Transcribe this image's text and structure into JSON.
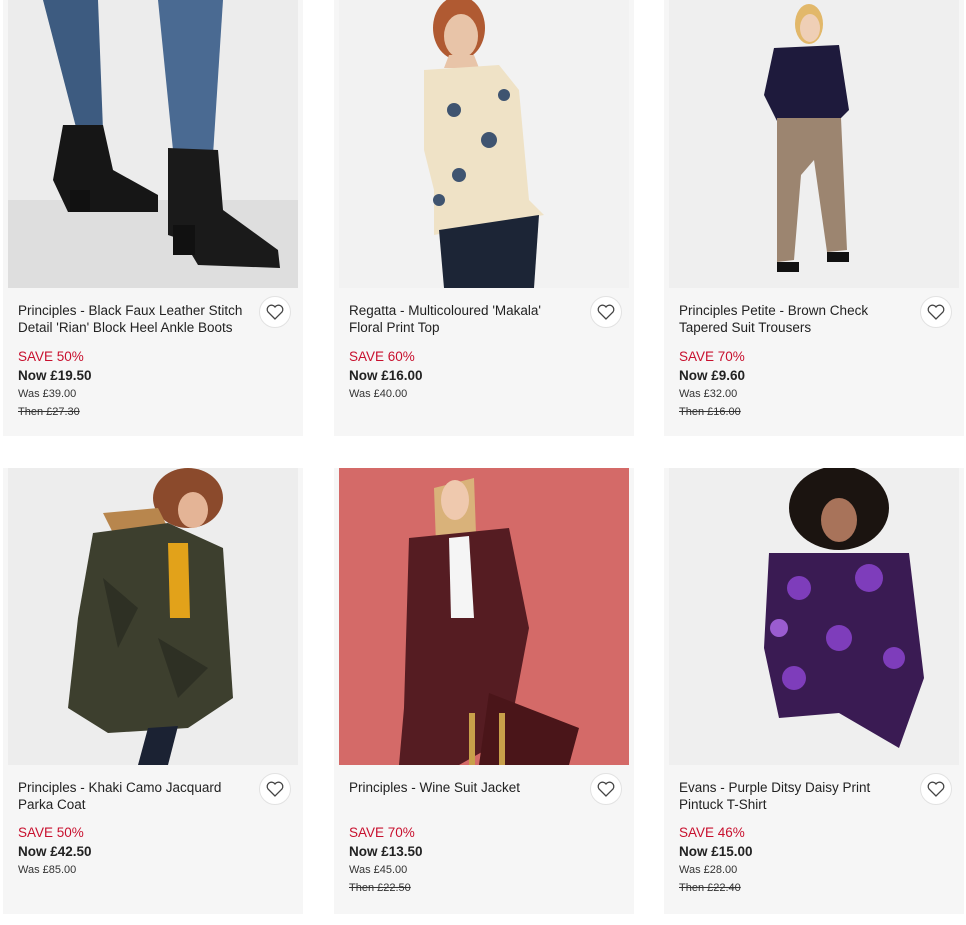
{
  "products": [
    {
      "name": "Principles - Black Faux Leather Stitch Detail 'Rian' Block Heel Ankle Boots",
      "save": "SAVE 50%",
      "now": "Now £19.50",
      "was": "Was £39.00",
      "then": "Then £27.30"
    },
    {
      "name": "Regatta - Multicoloured 'Makala' Floral Print Top",
      "save": "SAVE 60%",
      "now": "Now £16.00",
      "was": "Was £40.00",
      "then": ""
    },
    {
      "name": "Principles Petite - Brown Check Tapered Suit Trousers",
      "save": "SAVE 70%",
      "now": "Now £9.60",
      "was": "Was £32.00",
      "then": "Then £16.00"
    },
    {
      "name": "Principles - Khaki Camo Jacquard Parka Coat",
      "save": "SAVE 50%",
      "now": "Now £42.50",
      "was": "Was £85.00",
      "then": ""
    },
    {
      "name": "Principles - Wine Suit Jacket",
      "save": "SAVE 70%",
      "now": "Now £13.50",
      "was": "Was £45.00",
      "then": "Then £22.50"
    },
    {
      "name": "Evans - Purple Ditsy Daisy Print Pintuck T-Shirt",
      "save": "SAVE 46%",
      "now": "Now £15.00",
      "was": "Was £28.00",
      "then": "Then £22.40"
    }
  ],
  "icons": {
    "wishlist": "heart-outline-icon"
  },
  "colors": {
    "save": "#c8102e",
    "card_bg": "#f6f6f6"
  }
}
